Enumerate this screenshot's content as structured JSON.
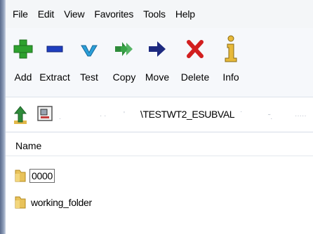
{
  "menu": {
    "items": [
      "File",
      "Edit",
      "View",
      "Favorites",
      "Tools",
      "Help"
    ]
  },
  "toolbar": {
    "buttons": [
      {
        "label": "Add",
        "icon": "plus-icon",
        "color": "#2ea12e"
      },
      {
        "label": "Extract",
        "icon": "minus-icon",
        "color": "#1f3fbf"
      },
      {
        "label": "Test",
        "icon": "check-icon",
        "color": "#2a9fd8"
      },
      {
        "label": "Copy",
        "icon": "double-arrow-icon",
        "color": "#2e8b3a"
      },
      {
        "label": "Move",
        "icon": "arrow-right-icon",
        "color": "#1d2a80"
      },
      {
        "label": "Delete",
        "icon": "x-icon",
        "color": "#d21f1f"
      },
      {
        "label": "Info",
        "icon": "info-icon",
        "color": "#d7a31a"
      }
    ]
  },
  "address": {
    "path_text": "\\TESTWT2_ESUBVAL"
  },
  "list": {
    "header_name": "Name",
    "items": [
      {
        "name": "0000",
        "selected": true
      },
      {
        "name": "working_folder",
        "selected": false
      }
    ]
  }
}
